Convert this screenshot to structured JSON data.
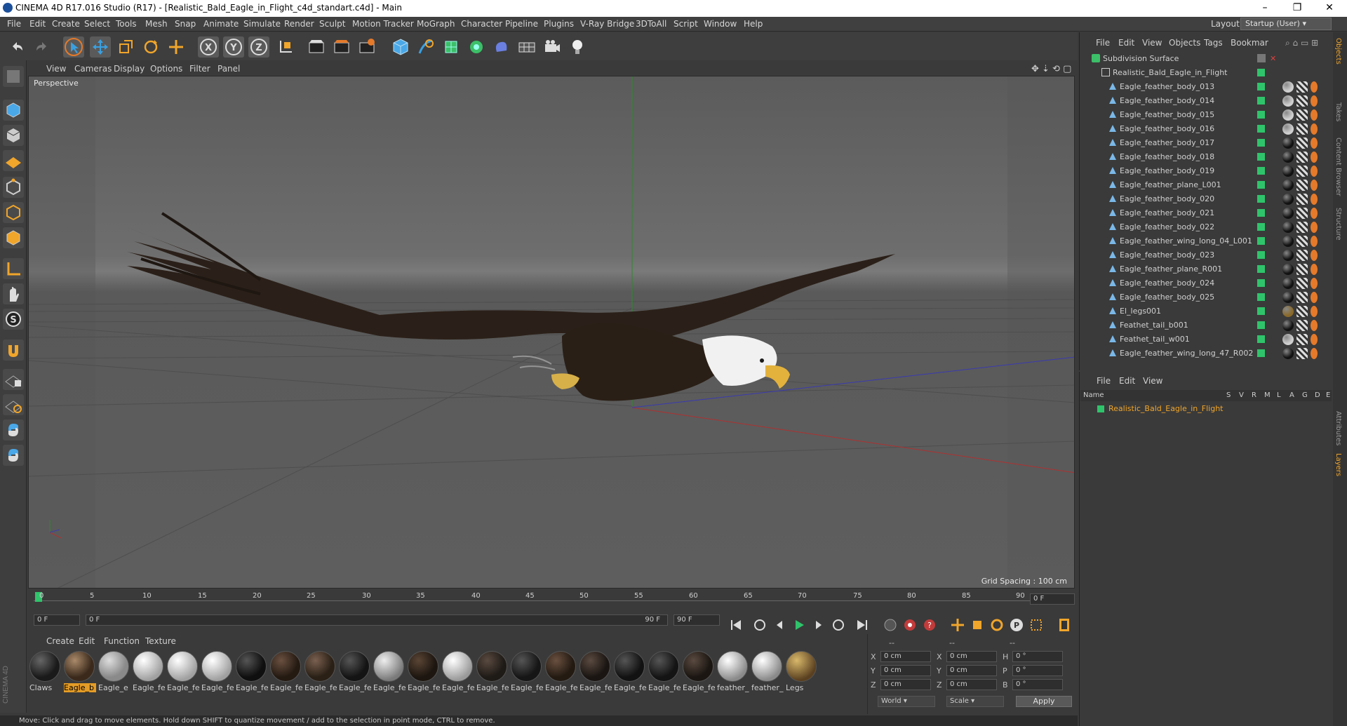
{
  "window": {
    "title": "CINEMA 4D R17.016 Studio (R17) - [Realistic_Bald_Eagle_in_Flight_c4d_standart.c4d] - Main",
    "minimize": "–",
    "restore": "❐",
    "close": "✕"
  },
  "menubar": {
    "items": [
      "File",
      "Edit",
      "Create",
      "Select",
      "Tools",
      "Mesh",
      "Snap",
      "Animate",
      "Simulate",
      "Render",
      "Sculpt",
      "Motion Tracker",
      "MoGraph",
      "Character",
      "Pipeline",
      "Plugins",
      "V-Ray Bridge",
      "3DToAll",
      "Script",
      "Window",
      "Help"
    ],
    "layout_label": "Layout:",
    "layout_value": "Startup (User)"
  },
  "toolbar": {
    "icons": [
      "undo-icon",
      "redo-icon",
      "select-icon",
      "move-icon",
      "scale-icon",
      "rotate-icon",
      "live-select-icon",
      "x-axis-icon",
      "y-axis-icon",
      "z-axis-icon",
      "coordinate-system-icon",
      "render-view-icon",
      "render-picture-viewer-icon",
      "render-settings-icon",
      "cube-icon",
      "pen-icon",
      "subdivision-icon",
      "cloner-icon",
      "deformer-icon",
      "floor-icon",
      "camera-icon",
      "light-icon"
    ]
  },
  "viewport": {
    "menu": [
      "View",
      "Cameras",
      "Display",
      "Options",
      "Filter",
      "Panel"
    ],
    "label": "Perspective",
    "grid_spacing": "Grid Spacing : 100 cm"
  },
  "timeline": {
    "ticks": [
      "0",
      "5",
      "10",
      "15",
      "20",
      "25",
      "30",
      "35",
      "40",
      "45",
      "50",
      "55",
      "60",
      "65",
      "70",
      "75",
      "80",
      "85",
      "90"
    ],
    "current_frame": "0 F",
    "start": "0 F",
    "range_start": "0 F",
    "range_end": "90 F",
    "end": "90 F"
  },
  "materials": {
    "menu": [
      "Create",
      "Edit",
      "Function",
      "Texture"
    ],
    "items": [
      {
        "label": "Claws",
        "color": "#1a1a1a"
      },
      {
        "label": "Eagle_b",
        "color": "#3b2a1c"
      },
      {
        "label": "Eagle_e",
        "color": "#8a8a8a"
      },
      {
        "label": "Eagle_fe",
        "color": "#dcdcdc"
      },
      {
        "label": "Eagle_fe",
        "color": "#dcdcdc"
      },
      {
        "label": "Eagle_fe",
        "color": "#dcdcdc"
      },
      {
        "label": "Eagle_fe",
        "color": "#0f0f0f"
      },
      {
        "label": "Eagle_fe",
        "color": "#241a12"
      },
      {
        "label": "Eagle_fe",
        "color": "#2a2016"
      },
      {
        "label": "Eagle_fe",
        "color": "#141414"
      },
      {
        "label": "Eagle_fe",
        "color": "#bdbdbd"
      },
      {
        "label": "Eagle_fe",
        "color": "#1d1610"
      },
      {
        "label": "Eagle_fe",
        "color": "#d8d8d8"
      },
      {
        "label": "Eagle_fe",
        "color": "#1e1a16"
      },
      {
        "label": "Eagle_fe",
        "color": "#161616"
      },
      {
        "label": "Eagle_fe",
        "color": "#231a12"
      },
      {
        "label": "Eagle_fe",
        "color": "#1a1512"
      },
      {
        "label": "Eagle_fe",
        "color": "#121212"
      },
      {
        "label": "Eagle_fe",
        "color": "#141414"
      },
      {
        "label": "Eagle_fe",
        "color": "#1b1612"
      },
      {
        "label": "feather_",
        "color": "#d0d0d0"
      },
      {
        "label": "feather_",
        "color": "#c8c8c8"
      },
      {
        "label": "Legs",
        "color": "#8a6a2a"
      }
    ]
  },
  "coords": {
    "rows": [
      {
        "a": "X",
        "av": "0 cm",
        "b": "X",
        "bv": "0 cm",
        "c": "H",
        "cv": "0 °"
      },
      {
        "a": "Y",
        "av": "0 cm",
        "b": "Y",
        "bv": "0 cm",
        "c": "P",
        "cv": "0 °"
      },
      {
        "a": "Z",
        "av": "0 cm",
        "b": "Z",
        "bv": "0 cm",
        "c": "B",
        "cv": "0 °"
      }
    ],
    "headers": [
      "--",
      "--",
      "--"
    ],
    "world": "World",
    "scale": "Scale",
    "apply": "Apply"
  },
  "objects": {
    "menu": [
      "File",
      "Edit",
      "View",
      "Objects",
      "Tags",
      "Bookmar"
    ],
    "root": "Subdivision Surface",
    "group": "Realistic_Bald_Eagle_in_Flight",
    "items": [
      {
        "name": "Eagle_feather_body_013",
        "tag": "#cfcfcf"
      },
      {
        "name": "Eagle_feather_body_014",
        "tag": "#cfcfcf"
      },
      {
        "name": "Eagle_feather_body_015",
        "tag": "#cfcfcf"
      },
      {
        "name": "Eagle_feather_body_016",
        "tag": "#cfcfcf"
      },
      {
        "name": "Eagle_feather_body_017",
        "tag": "#111111"
      },
      {
        "name": "Eagle_feather_body_018",
        "tag": "#111111"
      },
      {
        "name": "Eagle_feather_body_019",
        "tag": "#111111"
      },
      {
        "name": "Eagle_feather_plane_L001",
        "tag": "#111111"
      },
      {
        "name": "Eagle_feather_body_020",
        "tag": "#111111"
      },
      {
        "name": "Eagle_feather_body_021",
        "tag": "#111111"
      },
      {
        "name": "Eagle_feather_body_022",
        "tag": "#111111"
      },
      {
        "name": "Eagle_feather_wing_long_04_L001",
        "tag": "#111111"
      },
      {
        "name": "Eagle_feather_body_023",
        "tag": "#111111"
      },
      {
        "name": "Eagle_feather_plane_R001",
        "tag": "#111111"
      },
      {
        "name": "Eagle_feather_body_024",
        "tag": "#111111"
      },
      {
        "name": "Eagle_feather_body_025",
        "tag": "#111111"
      },
      {
        "name": "El_legs001",
        "tag": "#8a6a2a"
      },
      {
        "name": "Feathet_tail_b001",
        "tag": "#111111"
      },
      {
        "name": "Feathet_tail_w001",
        "tag": "#cfcfcf"
      },
      {
        "name": "Eagle_feather_wing_long_47_R002",
        "tag": "#111111"
      }
    ]
  },
  "layers": {
    "menu": [
      "File",
      "Edit",
      "View"
    ],
    "columns": [
      "Name",
      "S",
      "V",
      "R",
      "M",
      "L",
      "A",
      "G",
      "D",
      "E"
    ],
    "row": "Realistic_Bald_Eagle_in_Flight"
  },
  "sidetabs": [
    "Objects",
    "Takes",
    "Content Browser",
    "Structure",
    "Attributes",
    "Layers"
  ],
  "status": "Move: Click and drag to move elements. Hold down SHIFT to quantize movement / add to the selection in point mode, CTRL to remove.",
  "colors": {
    "accent": "#e49c26",
    "green": "#2fc46b",
    "layer": "#f0a52b"
  }
}
